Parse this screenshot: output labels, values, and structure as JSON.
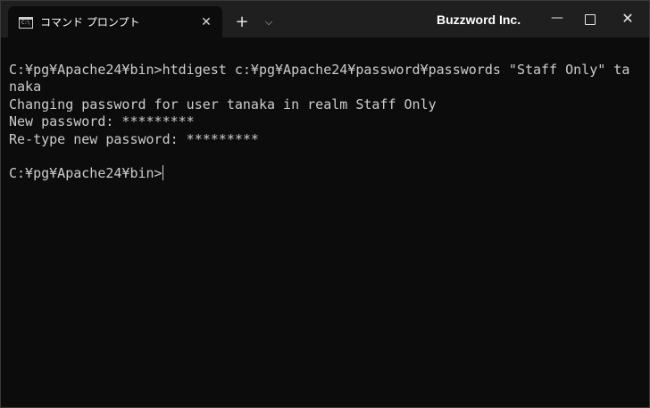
{
  "tab": {
    "icon_text": "C:\\",
    "title": "コマンド プロンプト",
    "close_glyph": "✕"
  },
  "titlebar": {
    "new_tab_glyph": "+",
    "dropdown_glyph": "⌵",
    "brand": "Buzzword Inc.",
    "minimize_glyph": "—",
    "close_glyph": "✕"
  },
  "terminal": {
    "lines": [
      "C:¥pg¥Apache24¥bin>htdigest c:¥pg¥Apache24¥password¥passwords \"Staff Only\" ta",
      "naka",
      "Changing password for user tanaka in realm Staff Only",
      "New password: *********",
      "Re-type new password: *********",
      "",
      "C:¥pg¥Apache24¥bin>"
    ]
  }
}
